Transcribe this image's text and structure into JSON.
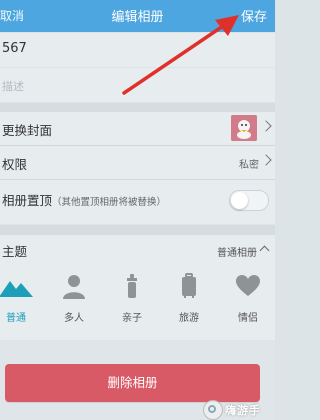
{
  "header": {
    "cancel_label": "取消",
    "title": "编辑相册",
    "save_label": "保存"
  },
  "album": {
    "name_value": "567",
    "description_placeholder": "描述"
  },
  "settings": {
    "cover_label": "更换封面",
    "permission_label": "权限",
    "permission_value": "私密",
    "pin_label": "相册置顶",
    "pin_note": "（其他置顶相册将被替换）",
    "pin_enabled": false
  },
  "theme": {
    "label": "主题",
    "value": "普通相册",
    "options": [
      {
        "label": "普通",
        "icon": "mountain-icon",
        "selected": true
      },
      {
        "label": "多人",
        "icon": "person-icon",
        "selected": false
      },
      {
        "label": "亲子",
        "icon": "baby-bottle-icon",
        "selected": false
      },
      {
        "label": "旅游",
        "icon": "suitcase-icon",
        "selected": false
      },
      {
        "label": "情侣",
        "icon": "heart-icon",
        "selected": false
      }
    ]
  },
  "actions": {
    "delete_label": "删除相册"
  },
  "watermark": {
    "text": "嗨游手"
  },
  "colors": {
    "header_bg": "#4da6e0",
    "accent": "#1c9fb8",
    "danger": "#d85a66",
    "annotation": "#e0302a"
  }
}
